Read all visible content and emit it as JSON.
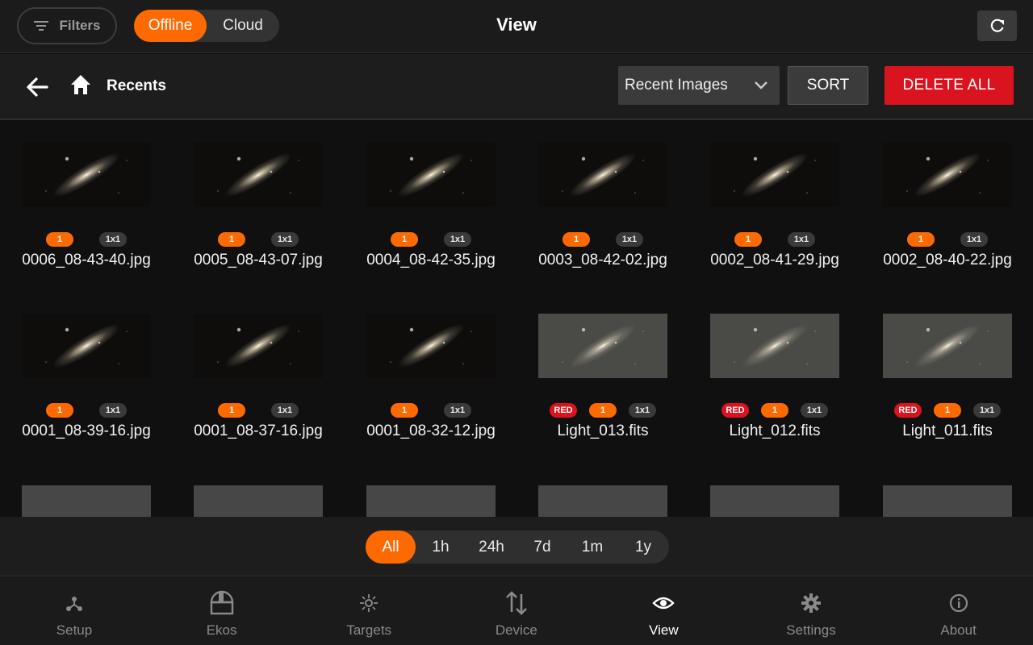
{
  "header": {
    "filters_label": "Filters",
    "mode_options": [
      "Offline",
      "Cloud"
    ],
    "mode_selected": "Offline",
    "title": "View"
  },
  "toolbar": {
    "breadcrumb": "Recents",
    "select_value": "Recent Images",
    "sort_label": "SORT",
    "delete_label": "DELETE ALL"
  },
  "images": [
    {
      "name": "0006_08-43-40.jpg",
      "badges": [
        "1",
        "1x1"
      ],
      "style": "dark"
    },
    {
      "name": "0005_08-43-07.jpg",
      "badges": [
        "1",
        "1x1"
      ],
      "style": "dark"
    },
    {
      "name": "0004_08-42-35.jpg",
      "badges": [
        "1",
        "1x1"
      ],
      "style": "dark"
    },
    {
      "name": "0003_08-42-02.jpg",
      "badges": [
        "1",
        "1x1"
      ],
      "style": "dark"
    },
    {
      "name": "0002_08-41-29.jpg",
      "badges": [
        "1",
        "1x1"
      ],
      "style": "dark"
    },
    {
      "name": "0002_08-40-22.jpg",
      "badges": [
        "1",
        "1x1"
      ],
      "style": "dark"
    },
    {
      "name": "0001_08-39-16.jpg",
      "badges": [
        "1",
        "1x1"
      ],
      "style": "dark"
    },
    {
      "name": "0001_08-37-16.jpg",
      "badges": [
        "1",
        "1x1"
      ],
      "style": "dark"
    },
    {
      "name": "0001_08-32-12.jpg",
      "badges": [
        "1",
        "1x1"
      ],
      "style": "dark"
    },
    {
      "name": "Light_013.fits",
      "badges": [
        "RED",
        "1",
        "1x1"
      ],
      "style": "gray"
    },
    {
      "name": "Light_012.fits",
      "badges": [
        "RED",
        "1",
        "1x1"
      ],
      "style": "gray"
    },
    {
      "name": "Light_011.fits",
      "badges": [
        "RED",
        "1",
        "1x1"
      ],
      "style": "gray"
    }
  ],
  "time_filter": {
    "options": [
      "All",
      "1h",
      "24h",
      "7d",
      "1m",
      "1y"
    ],
    "selected": "All"
  },
  "nav": {
    "items": [
      {
        "label": "Setup",
        "icon": "setup-icon"
      },
      {
        "label": "Ekos",
        "icon": "observatory-dome-icon"
      },
      {
        "label": "Targets",
        "icon": "targets-icon"
      },
      {
        "label": "Device",
        "icon": "device-arrows-icon"
      },
      {
        "label": "View",
        "icon": "eye-icon"
      },
      {
        "label": "Settings",
        "icon": "gear-icon"
      },
      {
        "label": "About",
        "icon": "info-icon"
      }
    ],
    "selected": "View"
  },
  "colors": {
    "accent": "#ff6a00",
    "danger": "#d9141f",
    "background": "#101010"
  }
}
